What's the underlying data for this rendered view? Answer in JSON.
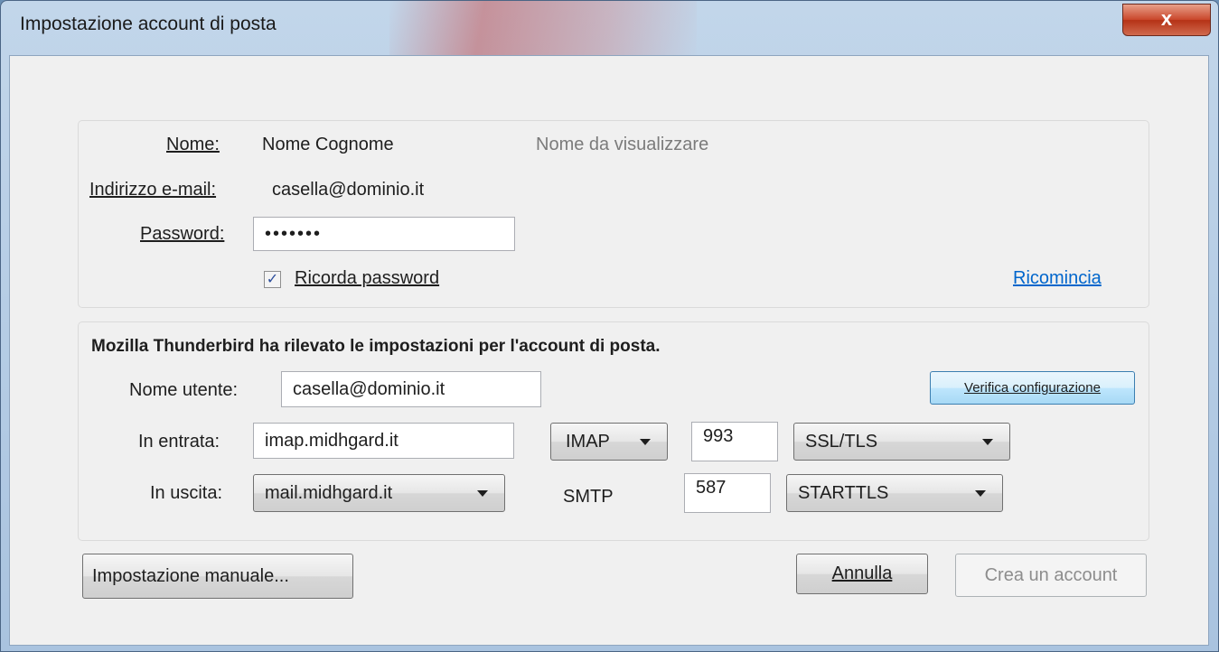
{
  "window": {
    "title": "Impostazione account di posta",
    "close_label": "x"
  },
  "account": {
    "name_label": "Nome:",
    "name_value": "Nome Cognome",
    "name_hint": "Nome da visualizzare",
    "email_label": "Indirizzo e-mail:",
    "email_value": "casella@dominio.it",
    "password_label": "Password:",
    "password_value": "•••••••",
    "remember_checked": true,
    "remember_label": "Ricorda password",
    "restart_link": "Ricomincia"
  },
  "config": {
    "detected_message": "Mozilla Thunderbird ha rilevato le impostazioni per l'account di posta.",
    "username_label": "Nome utente:",
    "username_value": "casella@dominio.it",
    "verify_button": "Verifica configurazione",
    "incoming": {
      "label": "In entrata:",
      "server": "imap.midhgard.it",
      "protocol": "IMAP",
      "port": "993",
      "security": "SSL/TLS"
    },
    "outgoing": {
      "label": "In uscita:",
      "server": "mail.midhgard.it",
      "protocol": "SMTP",
      "port": "587",
      "security": "STARTTLS"
    }
  },
  "footer": {
    "manual_button": "Impostazione manuale...",
    "cancel_button": "Annulla",
    "create_button": "Crea un account"
  }
}
